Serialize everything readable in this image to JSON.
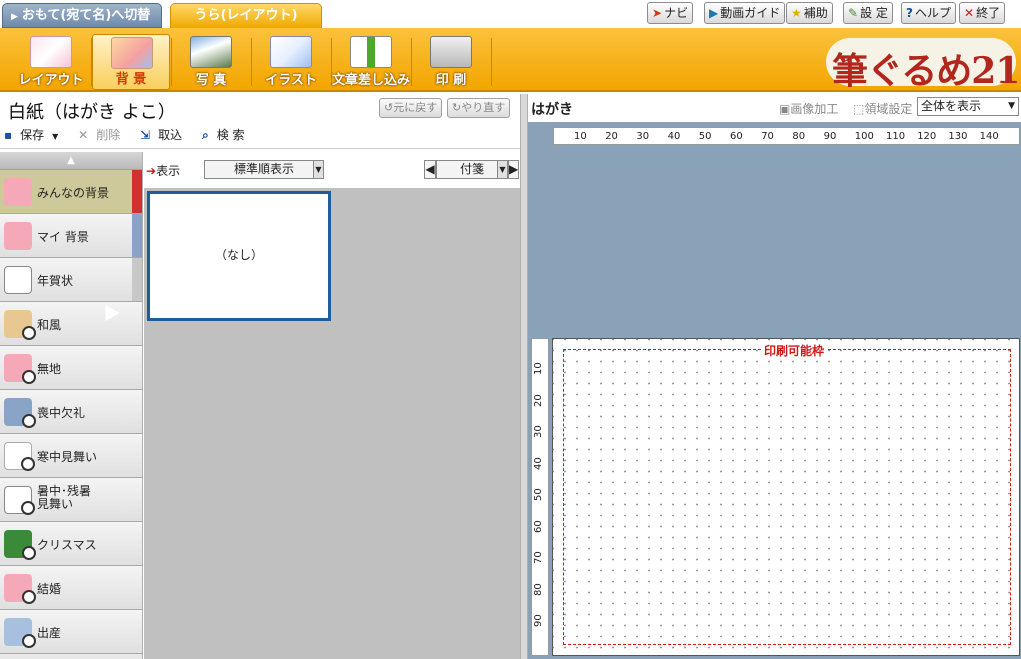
{
  "mode_tabs": {
    "front": "おもて(宛て名)へ切替",
    "back": "うら(レイアウト)"
  },
  "top_buttons": {
    "navi": "ナビ",
    "video_guide": "動画ガイド",
    "assist": "補助",
    "settings": "設 定",
    "help": "ヘルプ",
    "exit": "終了"
  },
  "toolbar": {
    "layout": "レイアウト",
    "background": "背 景",
    "photo": "写 真",
    "illust": "イラスト",
    "text_insert": "文章差し込み",
    "print": "印 刷",
    "logo": "筆ぐるめ21"
  },
  "document": {
    "title": "白紙（はがき よこ）",
    "undo": "元に戻す",
    "redo": "やり直す"
  },
  "file_bar": {
    "save": "保存",
    "delete": "削除",
    "import": "取込",
    "search": "検 索"
  },
  "categories": [
    {
      "label": "みんなの背景"
    },
    {
      "label": "マイ 背景"
    },
    {
      "label": "年賀状"
    },
    {
      "label": "和風"
    },
    {
      "label": "無地"
    },
    {
      "label": "喪中欠礼"
    },
    {
      "label": "寒中見舞い"
    },
    {
      "label": "暑中･残暑見舞い",
      "line1": "暑中･残暑",
      "line2": "見舞い"
    },
    {
      "label": "クリスマス"
    },
    {
      "label": "結婚"
    },
    {
      "label": "出産"
    }
  ],
  "list_header": {
    "show_label": "表示",
    "sort_value": "標準順表示",
    "tag_value": "付箋"
  },
  "thumbnails": [
    {
      "label": "（なし）"
    }
  ],
  "right_panel": {
    "card_label": "はがき",
    "image_edit": "画像加工",
    "area_settings": "領域設定",
    "zoom_value": "全体を表示",
    "print_area_label": "印刷可能枠"
  },
  "ruler": {
    "h_ticks": [
      "10",
      "20",
      "30",
      "40",
      "50",
      "60",
      "70",
      "80",
      "90",
      "100",
      "110",
      "120",
      "130",
      "140"
    ],
    "v_ticks": [
      "10",
      "20",
      "30",
      "40",
      "50",
      "60",
      "70",
      "80",
      "90"
    ]
  },
  "colors": {
    "toolbar": "#f3a500",
    "selected_tab": "#f0a800",
    "front_tab": "#6f8aaa",
    "active_category": "#cec99a",
    "print_frame": "#d01818",
    "canvas_bg": "#8aa2b8"
  }
}
